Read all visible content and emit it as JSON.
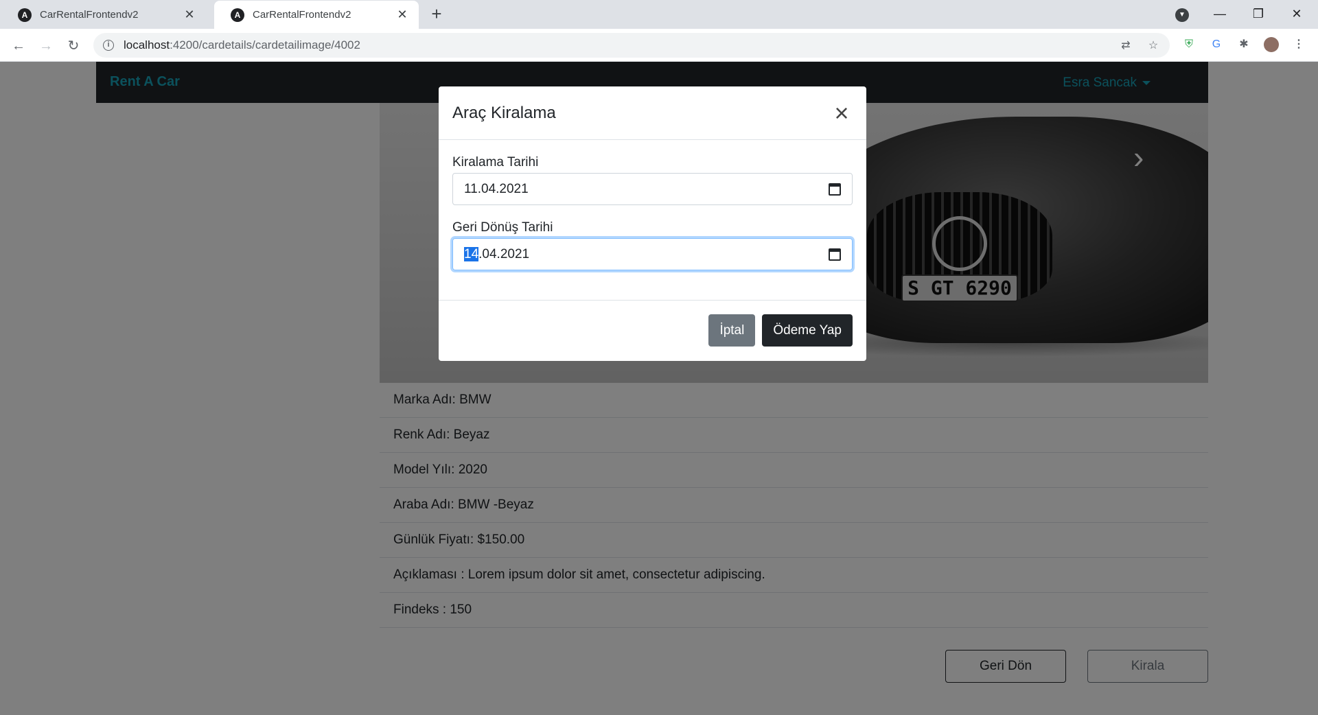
{
  "browser": {
    "tabs": [
      {
        "title": "CarRentalFrontendv2",
        "active": false
      },
      {
        "title": "CarRentalFrontendv2",
        "active": true
      }
    ],
    "url_host": "localhost",
    "url_path": ":4200/cardetails/cardetailimage/4002"
  },
  "navbar": {
    "brand": "Rent A Car",
    "user": "Esra Sancak"
  },
  "carousel": {
    "plate": "S GT 6290"
  },
  "details": [
    "Marka Adı: BMW",
    "Renk Adı: Beyaz",
    "Model Yılı: 2020",
    "Araba Adı: BMW -Beyaz",
    "Günlük Fiyatı: $150.00",
    "Açıklaması : Lorem ipsum dolor sit amet, consectetur adipiscing.",
    "Findeks : 150"
  ],
  "actions": {
    "back_label": "Geri Dön",
    "rent_label": "Kirala"
  },
  "modal": {
    "title": "Araç Kiralama",
    "rent_date_label": "Kiralama Tarihi",
    "rent_date_value": "11.04.2021",
    "return_date_label": "Geri Dönüş Tarihi",
    "return_date_selected": "14",
    "return_date_rest": ".04.2021",
    "cancel_label": "İptal",
    "pay_label": "Ödeme Yap"
  },
  "colors": {
    "navbar_bg": "#212529",
    "brand": "#17a2b8",
    "secondary": "#6c757d",
    "dark": "#212529"
  }
}
